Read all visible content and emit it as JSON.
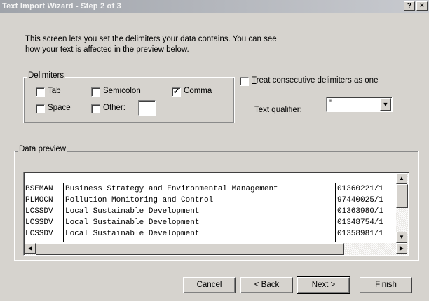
{
  "window": {
    "title": "Text Import Wizard - Step 2 of 3",
    "help_label": "?",
    "close_label": "×"
  },
  "intro": {
    "line1": "This screen lets you set the delimiters your data contains.  You can see",
    "line2": "how your text is affected in the preview below."
  },
  "delimiters": {
    "legend": "Delimiters",
    "tab": {
      "pre": "",
      "key": "T",
      "post": "ab",
      "checked": false
    },
    "semicolon": {
      "pre": "Se",
      "key": "m",
      "post": "icolon",
      "checked": false
    },
    "comma": {
      "pre": "",
      "key": "C",
      "post": "omma",
      "checked": true
    },
    "space": {
      "pre": "",
      "key": "S",
      "post": "pace",
      "checked": false
    },
    "other": {
      "pre": "",
      "key": "O",
      "post": "ther:",
      "checked": false,
      "value": ""
    }
  },
  "consecutive": {
    "pre": "",
    "key": "T",
    "post": "reat consecutive delimiters as one",
    "checked": false
  },
  "qualifier": {
    "pre": "Text ",
    "key": "q",
    "post": "ualifier:",
    "value": "\""
  },
  "preview": {
    "legend": "Data preview",
    "rows": [
      {
        "code": "BSEMAN",
        "title": "Business Strategy and Environmental Management",
        "id": "01360221/1"
      },
      {
        "code": "PLMOCN",
        "title": "Pollution Monitoring and Control",
        "id": "97440025/1"
      },
      {
        "code": "LCSSDV",
        "title": "Local Sustainable Development",
        "id": "01363980/1"
      },
      {
        "code": "LCSSDV",
        "title": "Local Sustainable Development",
        "id": "01348754/1"
      },
      {
        "code": "LCSSDV",
        "title": "Local Sustainable Development",
        "id": "01358981/1"
      }
    ],
    "up_arrow": "▲",
    "down_arrow": "▼",
    "left_arrow": "◀",
    "right_arrow": "▶"
  },
  "buttons": {
    "cancel": "Cancel",
    "back": {
      "pre": "< ",
      "key": "B",
      "post": "ack"
    },
    "next": "Next >",
    "finish": {
      "pre": "",
      "key": "F",
      "post": "inish"
    }
  },
  "checkmark": "✓",
  "dropdown_arrow": "▼"
}
